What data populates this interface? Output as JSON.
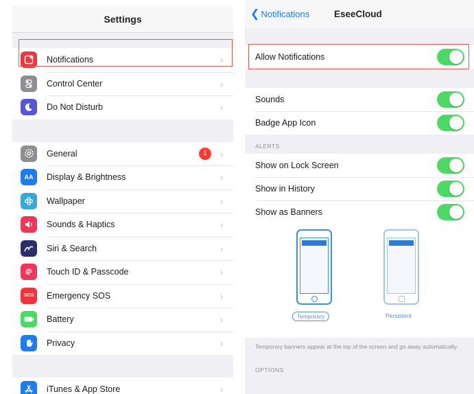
{
  "left_panel": {
    "title": "Settings",
    "group1": [
      {
        "label": "Notifications",
        "icon": "notifications-icon",
        "color": "#f2353a"
      },
      {
        "label": "Control Center",
        "icon": "control-center-icon",
        "color": "#8e8e93"
      },
      {
        "label": "Do Not Disturb",
        "icon": "moon-icon",
        "color": "#5856d6"
      }
    ],
    "group2": [
      {
        "label": "General",
        "icon": "gear-icon",
        "color": "#8e8e93",
        "badge": "1"
      },
      {
        "label": "Display & Brightness",
        "icon": "display-icon",
        "color": "#1e7cf2"
      },
      {
        "label": "Wallpaper",
        "icon": "wallpaper-icon",
        "color": "#34aadc"
      },
      {
        "label": "Sounds & Haptics",
        "icon": "speaker-icon",
        "color": "#f2355a"
      },
      {
        "label": "Siri & Search",
        "icon": "siri-icon",
        "color": "#2c2c6e"
      },
      {
        "label": "Touch ID & Passcode",
        "icon": "fingerprint-icon",
        "color": "#f2355a"
      },
      {
        "label": "Emergency SOS",
        "icon": "sos-icon",
        "color": "#f2353a"
      },
      {
        "label": "Battery",
        "icon": "battery-icon",
        "color": "#4cd964"
      },
      {
        "label": "Privacy",
        "icon": "hand-icon",
        "color": "#1e7cf2"
      }
    ],
    "group3": [
      {
        "label": "iTunes & App Store",
        "icon": "app-store-icon",
        "color": "#1e7cf2"
      }
    ]
  },
  "right_panel": {
    "back_label": "Notifications",
    "title": "EseeCloud",
    "allow_notifications": {
      "label": "Allow Notifications",
      "on": true
    },
    "sounds": {
      "label": "Sounds",
      "on": true
    },
    "badge_app_icon": {
      "label": "Badge App Icon",
      "on": true
    },
    "alerts_header": "ALERTS",
    "show_on_lock_screen": {
      "label": "Show on Lock Screen",
      "on": true
    },
    "show_in_history": {
      "label": "Show in History",
      "on": true
    },
    "show_as_banners": {
      "label": "Show as Banners",
      "on": true
    },
    "banner_temporary": "Temporary",
    "banner_persistent": "Persistent",
    "footnote": "Temporary banners appear at the top of the screen and go away automatically.",
    "options_header": "OPTIONS"
  },
  "colors": {
    "toggle_on": "#4cd964",
    "accent": "#1e7cf2",
    "highlight_box": "#e15a58"
  }
}
